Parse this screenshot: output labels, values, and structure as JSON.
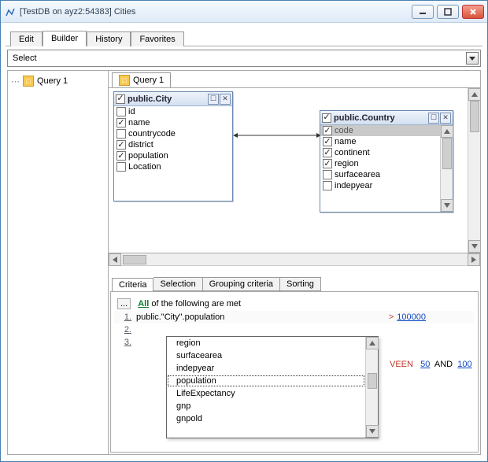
{
  "window": {
    "title": "[TestDB on ayz2:54383] Cities"
  },
  "main_tabs": [
    "Edit",
    "Builder",
    "History",
    "Favorites"
  ],
  "active_main_tab": 1,
  "select_combo": "Select",
  "tree": {
    "items": [
      {
        "label": "Query 1"
      }
    ]
  },
  "query_tabs": [
    "Query 1"
  ],
  "tables": {
    "city": {
      "title": "public.City",
      "header_checked": true,
      "fields": [
        {
          "name": "id",
          "checked": false
        },
        {
          "name": "name",
          "checked": true
        },
        {
          "name": "countrycode",
          "checked": false
        },
        {
          "name": "district",
          "checked": true
        },
        {
          "name": "population",
          "checked": true
        },
        {
          "name": "Location",
          "checked": false
        }
      ]
    },
    "country": {
      "title": "public.Country",
      "header_checked": true,
      "fields": [
        {
          "name": "code",
          "checked": true,
          "selected": true
        },
        {
          "name": "name",
          "checked": true
        },
        {
          "name": "continent",
          "checked": true
        },
        {
          "name": "region",
          "checked": true
        },
        {
          "name": "surfacearea",
          "checked": false
        },
        {
          "name": "indepyear",
          "checked": false
        }
      ]
    }
  },
  "lower_tabs": [
    "Criteria",
    "Selection",
    "Grouping criteria",
    "Sorting"
  ],
  "criteria": {
    "header_all": "All",
    "header_rest": " of the following are met",
    "rows": [
      {
        "num": "1.",
        "expr": "public.\"City\".population",
        "op": ">",
        "val": "100000"
      },
      {
        "num": "2.",
        "expr": "",
        "op": "",
        "val": ""
      },
      {
        "num": "3.",
        "expr": "",
        "op": "",
        "val": ""
      }
    ],
    "popup": {
      "items": [
        "region",
        "surfacearea",
        "indepyear",
        "population",
        "LifeExpectancy",
        "gnp",
        "gnpold"
      ],
      "focus_index": 3
    },
    "tail": {
      "kw": "VEEN",
      "v1": "50",
      "and": "AND",
      "v2": "100"
    }
  }
}
